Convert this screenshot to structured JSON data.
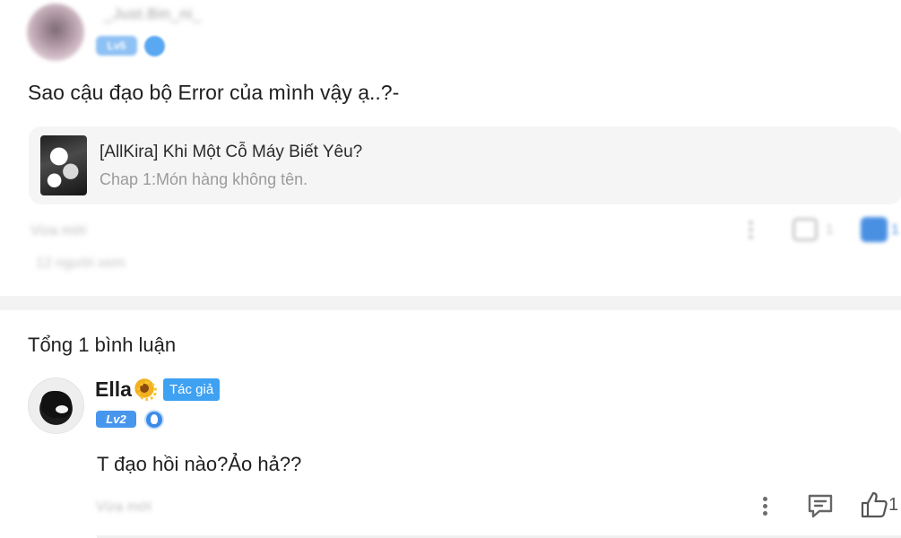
{
  "post": {
    "username": "_Just.Bin_ni_",
    "level_badge": "Lv5",
    "text": "Sao cậu đạo bộ Error của mình vậy ạ..?-",
    "story": {
      "title": "[AllKira] Khi Một Cỗ Máy Biết Yêu?",
      "chapter": "Chap 1:Món hàng không tên."
    },
    "time": "Vừa mới",
    "reply_count": "1",
    "like_count": "1",
    "meta": "12 người xem"
  },
  "comments": {
    "total_label": "Tổng 1 bình luận",
    "items": [
      {
        "name": "Ella",
        "name_emoji_icon": "sunflower-icon",
        "author_badge": "Tác giả",
        "level_badge": "Lv2",
        "text": "T đạo hồi nào?Ảo hả??",
        "time": "Vừa mới",
        "like_count": "1"
      }
    ]
  },
  "colors": {
    "accent_blue": "#3ea1f2",
    "badge_blue": "#4796ee",
    "card_bg": "#f5f5f6",
    "divider": "#f3f3f4"
  }
}
